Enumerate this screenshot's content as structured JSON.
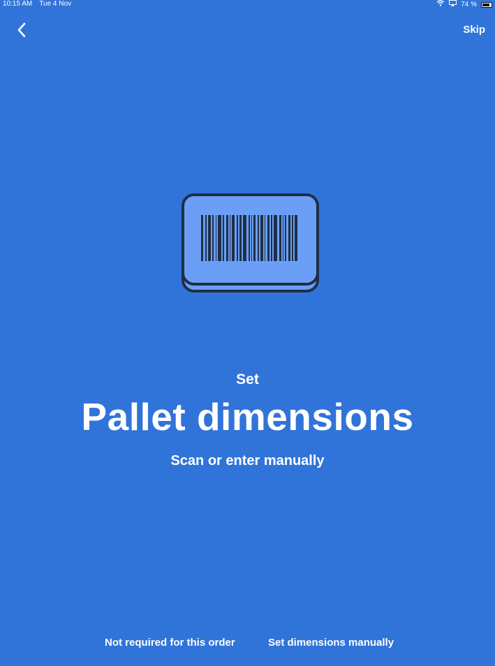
{
  "status_bar": {
    "time": "10:15 AM",
    "date": "Tue 4 Nov",
    "battery": "74 %",
    "battery_level": 0.74,
    "icons": [
      "wifi-icon",
      "screen-mirroring-icon",
      "battery-icon"
    ]
  },
  "nav": {
    "back_icon": "chevron-left-icon",
    "skip_label": "Skip"
  },
  "illustration": {
    "icon": "barcode-icon",
    "colors": {
      "card_fill": "#6b9ff7",
      "outline": "#1f2f47",
      "bars": "#1f2f47"
    }
  },
  "main": {
    "pre_title": "Set",
    "title": "Pallet dimensions",
    "subtitle": "Scan or enter manually"
  },
  "actions": {
    "not_required": "Not required for this order",
    "set_manually": "Set dimensions manually"
  },
  "colors": {
    "background": "#3174d9",
    "text": "#ffffff"
  }
}
